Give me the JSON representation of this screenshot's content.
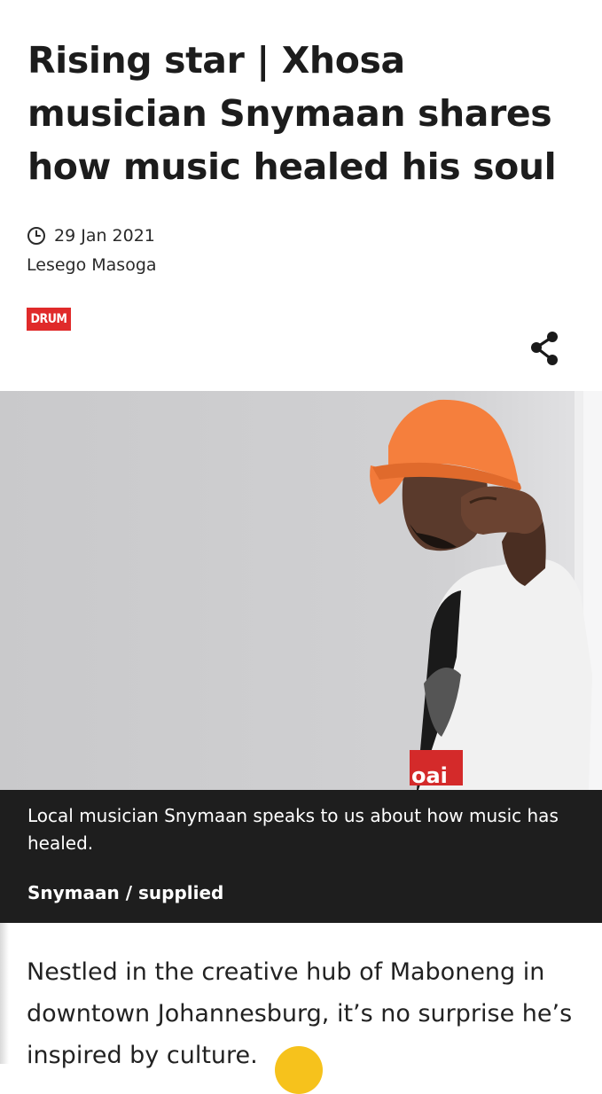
{
  "article": {
    "title": "Rising star | Xhosa musician Snymaan shares how music healed his soul",
    "date": "29 Jan 2021",
    "author": "Lesego Masoga",
    "brand": "DRUM",
    "body": "Nestled  in the creative  hub of Maboneng in  downtown Johannesburg,  it’s no surprise he’s  inspired by culture."
  },
  "icons": {
    "date": "clock-icon",
    "share": "share-icon"
  },
  "hero": {
    "caption": "Local musician Snymaan speaks to us about how music has healed.",
    "credit": "Snymaan / supplied",
    "shirt_text": "oai"
  },
  "colors": {
    "brand_red": "#e02a2a",
    "caption_bg": "#1e1e1e",
    "hat_orange": "#f27a3a",
    "photo_bg": "#cfcfd0"
  }
}
